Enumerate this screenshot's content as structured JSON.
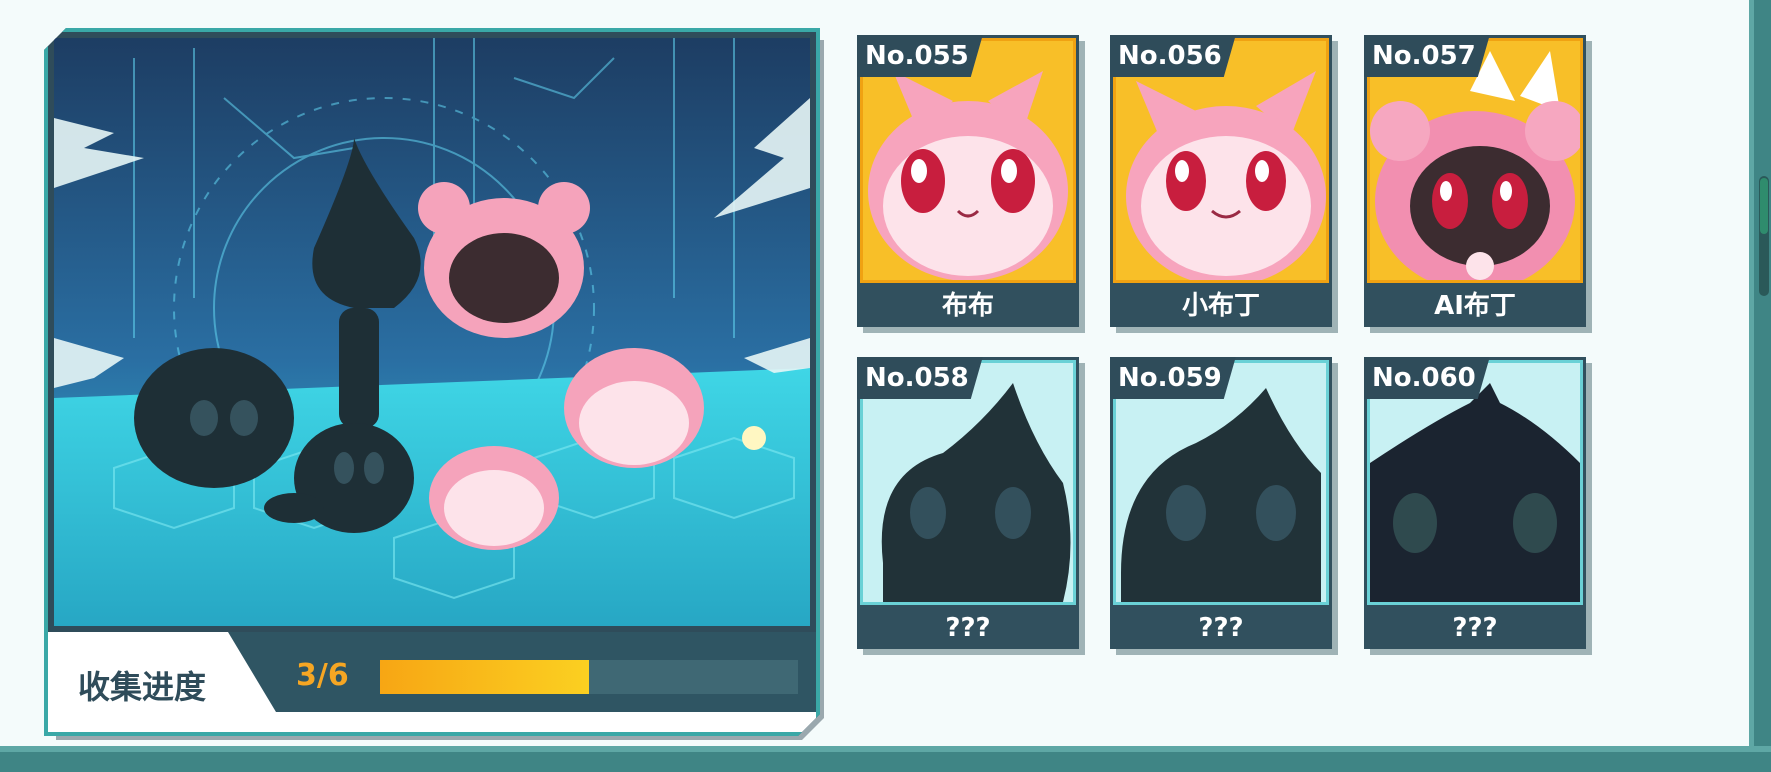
{
  "collection": {
    "progress_label": "收集进度",
    "count_text": "3/6",
    "progress_fraction": 0.5
  },
  "cards": [
    {
      "number": "No.055",
      "name": "布布",
      "collected": true
    },
    {
      "number": "No.056",
      "name": "小布丁",
      "collected": true
    },
    {
      "number": "No.057",
      "name": "AI布丁",
      "collected": true
    },
    {
      "number": "No.058",
      "name": "???",
      "collected": false
    },
    {
      "number": "No.059",
      "name": "???",
      "collected": false
    },
    {
      "number": "No.060",
      "name": "???",
      "collected": false
    }
  ],
  "colors": {
    "panel": "#2f4c5a",
    "frame": "#3aa8a7",
    "gold_card": "#f8bf28",
    "locked_card": "#c8f1f3",
    "progress_fill": "#fbd021",
    "progress_text": "#f6a623"
  }
}
